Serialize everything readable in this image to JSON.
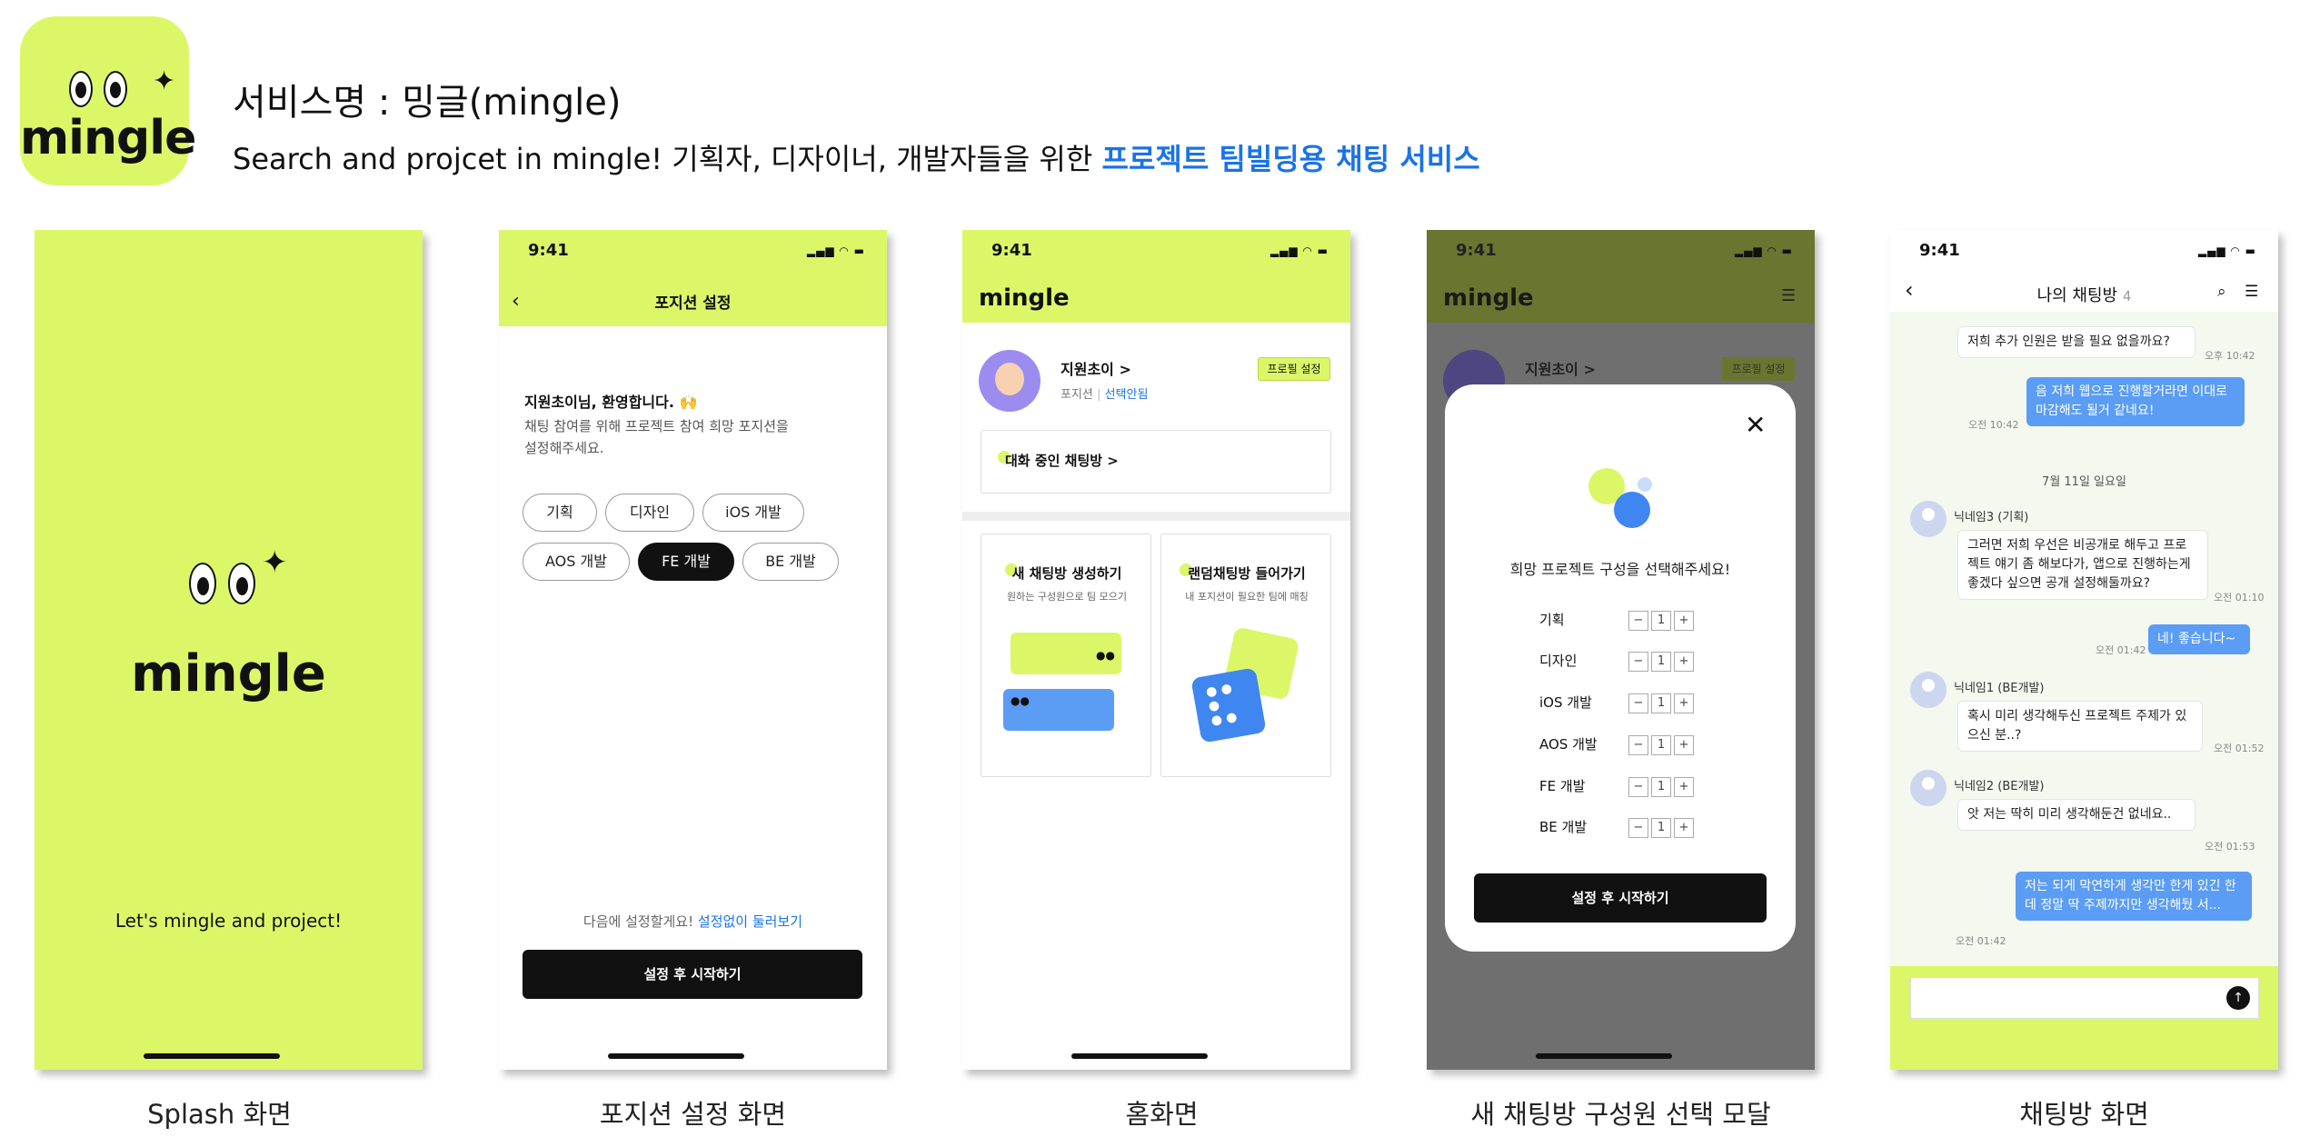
{
  "header": {
    "logo_text": "mingle",
    "title": "서비스명 : 밍글(mingle)",
    "subtitle_main": "Search and projcet in mingle! 기획자, 디자이너, 개발자들을 위한 ",
    "subtitle_highlight": "프로젝트 팀빌딩용 채팅 서비스"
  },
  "colors": {
    "brand_lime": "#dbf768",
    "accent_blue": "#1a73e8",
    "bubble_blue": "#5b9cf5",
    "dim_overlay": "#6f6f6f"
  },
  "status": {
    "time": "9:41"
  },
  "splash": {
    "logo_text": "mingle",
    "tagline": "Let's mingle and project!",
    "caption": "Splash 화면"
  },
  "position": {
    "nav_title": "포지션 설정",
    "welcome": "지원초이님, 환영합니다. 🙌",
    "desc_line1": "채팅 참여를 위해 프로젝트 참여 희망 포지션을",
    "desc_line2": "설정해주세요.",
    "chips": [
      "기획",
      "디자인",
      "iOS 개발",
      "AOS 개발",
      "FE 개발",
      "BE 개발"
    ],
    "selected_chip": "FE 개발",
    "later_text": "다음에 설정할게요!",
    "browse_link": "설정없이 둘러보기",
    "start_button": "설정 후 시작하기",
    "caption": "포지션 설정 화면"
  },
  "home": {
    "logo_text": "mingle",
    "user_name": "지원초이 >",
    "position_label": "포지션",
    "position_value": "선택안됨",
    "profile_button": "프로필 설정",
    "active_chat": "대화 중인 채팅방 >",
    "card_new_title": "새 채팅방 생성하기",
    "card_new_desc": "원하는 구성원으로 팀 모으기",
    "card_random_title": "랜덤채팅방 들어가기",
    "card_random_desc": "내 포지션이 필요한 팀에 매칭",
    "caption": "홈화면"
  },
  "modal": {
    "logo_text": "mingle",
    "user_name": "지원초이 >",
    "profile_button": "프로필 설정",
    "prompt": "희망 프로젝트 구성을 선택해주세요!",
    "rows": [
      {
        "label": "기획",
        "count": "1"
      },
      {
        "label": "디자인",
        "count": "1"
      },
      {
        "label": "iOS 개발",
        "count": "1"
      },
      {
        "label": "AOS 개발",
        "count": "1"
      },
      {
        "label": "FE 개발",
        "count": "1"
      },
      {
        "label": "BE 개발",
        "count": "1"
      }
    ],
    "minus": "−",
    "plus": "+",
    "start_button": "설정 후 시작하기",
    "caption": "새 채팅방 구성원 선택 모달"
  },
  "chat": {
    "title": "나의 채팅방",
    "member_count": "4",
    "msg1": "저희 추가 인원은 받을 필요 없을까요?",
    "msg1_time": "오후 10:42",
    "msg2": "음 저희 웹으로 진행할거라면 이대로 마감해도 될거 같네요!",
    "msg2_time": "오전 10:42",
    "date_divider": "7월 11일 일요일",
    "nick3": "닉네임3 (기획)",
    "msg3": "그러면 저희 우선은 비공개로 해두고 프로젝트 얘기 좀 해보다가, 앱으로 진행하는게 좋겠다 싶으면 공개 설정해둘까요?",
    "msg3_time": "오전 01:10",
    "msg4": "네! 좋습니다~",
    "msg4_time": "오전 01:42",
    "nick1": "닉네임1 (BE개발)",
    "msg5": "혹시 미리 생각해두신 프로젝트 주제가 있으신 분..?",
    "msg5_time": "오전 01:52",
    "nick2": "닉네임2 (BE개발)",
    "msg6": "앗 저는 딱히 미리 생각해둔건 없네요..",
    "msg6_time": "오전 01:53",
    "msg7": "저는 되게 막연하게 생각만 한게 있긴 한데 정말 딱 주제까지만 생각해뒀 서...",
    "msg7_time": "오전 01:42",
    "caption": "채팅방 화면"
  }
}
